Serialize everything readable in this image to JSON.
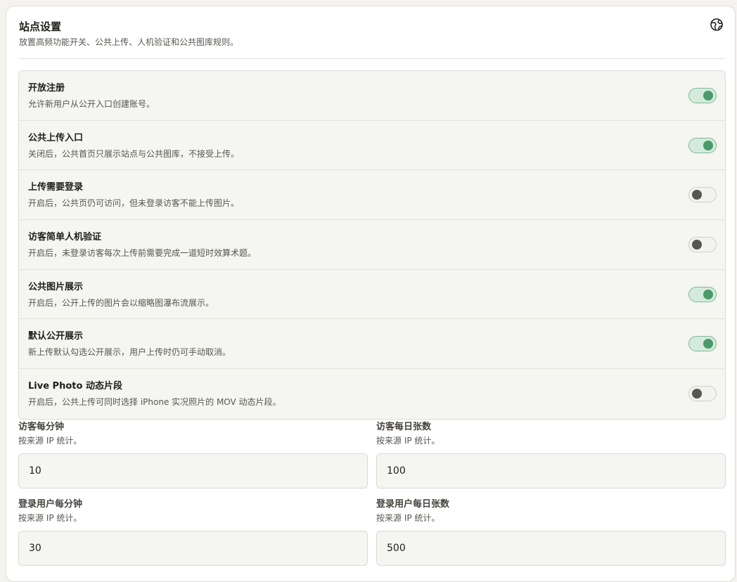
{
  "header": {
    "title": "站点设置",
    "subtitle": "放置高频功能开关、公共上传、人机验证和公共图库规则。",
    "icon": "globe-icon"
  },
  "toggles": [
    {
      "title": "开放注册",
      "desc": "允许新用户从公开入口创建账号。",
      "enabled": true
    },
    {
      "title": "公共上传入口",
      "desc": "关闭后，公共首页只展示站点与公共图库，不接受上传。",
      "enabled": true
    },
    {
      "title": "上传需要登录",
      "desc": "开启后，公共页仍可访问，但未登录访客不能上传图片。",
      "enabled": false
    },
    {
      "title": "访客简单人机验证",
      "desc": "开启后，未登录访客每次上传前需要完成一道短时效算术题。",
      "enabled": false
    },
    {
      "title": "公共图片展示",
      "desc": "开启后，公开上传的图片会以缩略图瀑布流展示。",
      "enabled": true
    },
    {
      "title": "默认公开展示",
      "desc": "新上传默认勾选公开展示，用户上传时仍可手动取消。",
      "enabled": true
    },
    {
      "title": "Live Photo 动态片段",
      "desc": "开启后，公共上传可同时选择 iPhone 实况照片的 MOV 动态片段。",
      "enabled": false
    }
  ],
  "fields": [
    {
      "label": "访客每分钟",
      "hint": "按来源 IP 统计。",
      "value": "10"
    },
    {
      "label": "访客每日张数",
      "hint": "按来源 IP 统计。",
      "value": "100"
    },
    {
      "label": "登录用户每分钟",
      "hint": "按来源 IP 统计。",
      "value": "30"
    },
    {
      "label": "登录用户每日张数",
      "hint": "按来源 IP 统计。",
      "value": "500"
    }
  ],
  "colors": {
    "accent": "#4b9a69",
    "accent_track": "#d4ebdc",
    "off_knob": "#57564f"
  }
}
